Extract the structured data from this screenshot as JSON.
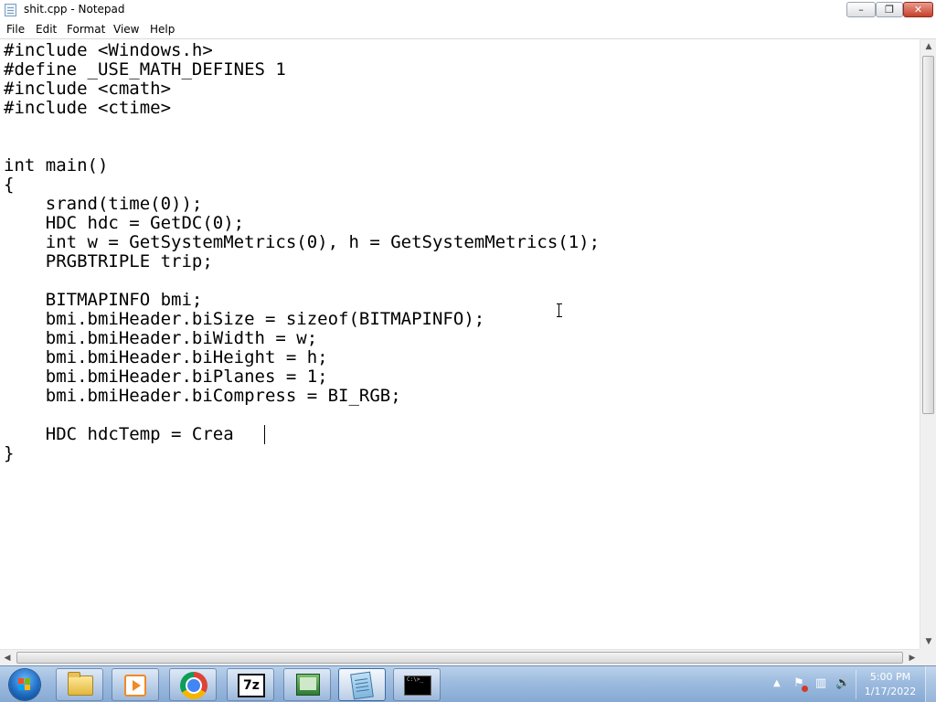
{
  "window": {
    "title": "shit.cpp - Notepad",
    "controls": {
      "minimize": "–",
      "maximize": "❐",
      "close": "✕"
    }
  },
  "menu": [
    "File",
    "Edit",
    "Format",
    "View",
    "Help"
  ],
  "editor": {
    "lines": [
      "#include <Windows.h>",
      "#define _USE_MATH_DEFINES 1",
      "#include <cmath>",
      "#include <ctime>",
      "",
      "",
      "int main()",
      "{",
      "    srand(time(0));",
      "    HDC hdc = GetDC(0);",
      "    int w = GetSystemMetrics(0), h = GetSystemMetrics(1);",
      "    PRGBTRIPLE trip;",
      "",
      "    BITMAPINFO bmi;",
      "    bmi.bmiHeader.biSize = sizeof(BITMAPINFO);",
      "    bmi.bmiHeader.biWidth = w;",
      "    bmi.bmiHeader.biHeight = h;",
      "    bmi.bmiHeader.biPlanes = 1;",
      "    bmi.bmiHeader.biCompress = BI_RGB;",
      "",
      "    HDC hdcTemp = Crea",
      "}"
    ]
  },
  "scrollbars": {
    "up": "▲",
    "down": "▼",
    "left": "◀",
    "right": "▶"
  },
  "taskbar": {
    "apps": [
      {
        "name": "Windows Explorer",
        "icon": "folder-icon"
      },
      {
        "name": "Windows Media Player",
        "icon": "media-player-icon"
      },
      {
        "name": "Google Chrome",
        "icon": "chrome-icon"
      },
      {
        "name": "7-Zip",
        "icon": "7zip-icon",
        "glyph": "7z"
      },
      {
        "name": "Network",
        "icon": "network-icon"
      },
      {
        "name": "Notepad",
        "icon": "notepad-icon",
        "active": true
      },
      {
        "name": "Command Prompt",
        "icon": "cmd-icon",
        "glyph": "C:\\>_"
      }
    ],
    "tray": {
      "chevron": "▲",
      "volume": "🔊",
      "network": "▥"
    },
    "clock": {
      "time": "5:00 PM",
      "date": "1/17/2022"
    }
  },
  "colors": {
    "taskbar": "#9dbbdf",
    "close_button": "#c7402a",
    "editor_bg": "#ffffff"
  }
}
